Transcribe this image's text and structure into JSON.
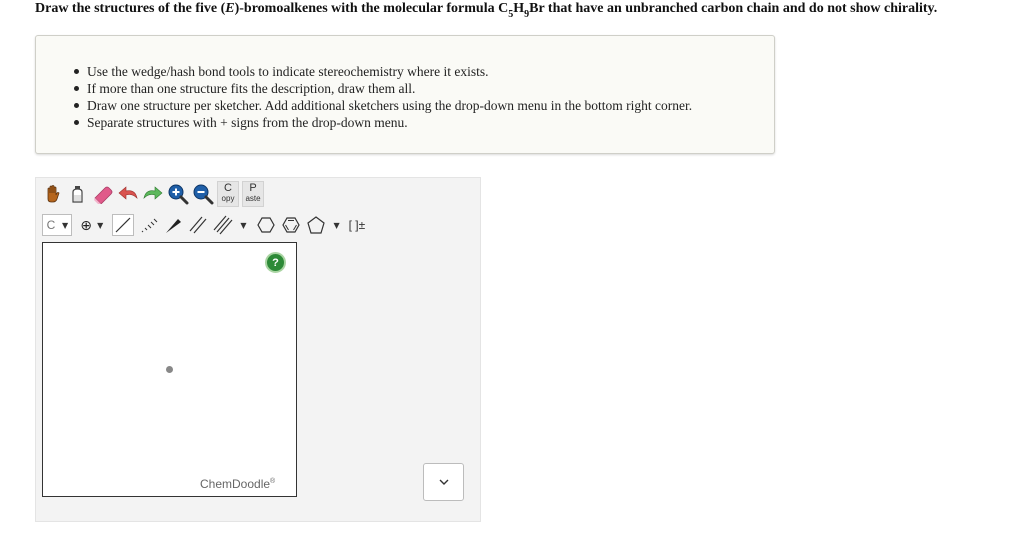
{
  "question": {
    "prefix": "Draw the structures of the five (",
    "isomer": "E",
    "middle": ")-bromoalkenes with the molecular formula C",
    "c_sub": "5",
    "h": "H",
    "h_sub": "9",
    "suffix": "Br that have an unbranched carbon chain and do not show chirality."
  },
  "instructions": [
    "Use the wedge/hash bond tools to indicate stereochemistry where it exists.",
    "If more than one structure fits the description, draw them all.",
    "Draw one structure per sketcher. Add additional sketchers using the drop-down menu in the bottom right corner.",
    "Separate structures with + signs from the drop-down menu."
  ],
  "toolbar": {
    "copy_big": "C",
    "copy_small": "opy",
    "paste_big": "P",
    "paste_small": "aste",
    "atom_label": "C",
    "charge_label": "⊕",
    "caret": "▼",
    "bracket_label": "[ ]±"
  },
  "icons": {
    "hand": "hand-icon",
    "bottle": "bottle-icon",
    "eraser": "eraser-icon",
    "undo": "undo-icon",
    "redo": "redo-icon",
    "zoom_in": "zoom-in-icon",
    "zoom_out": "zoom-out-icon"
  },
  "canvas": {
    "help": "?",
    "watermark": "ChemDoodle",
    "watermark_mark": "®"
  },
  "colors": {
    "help_green": "#2d8a37",
    "undo_red": "#d9534f",
    "redo_green": "#5cb85c",
    "zoom_blue": "#1f5fa8",
    "eraser_pink": "#e05a8a"
  }
}
